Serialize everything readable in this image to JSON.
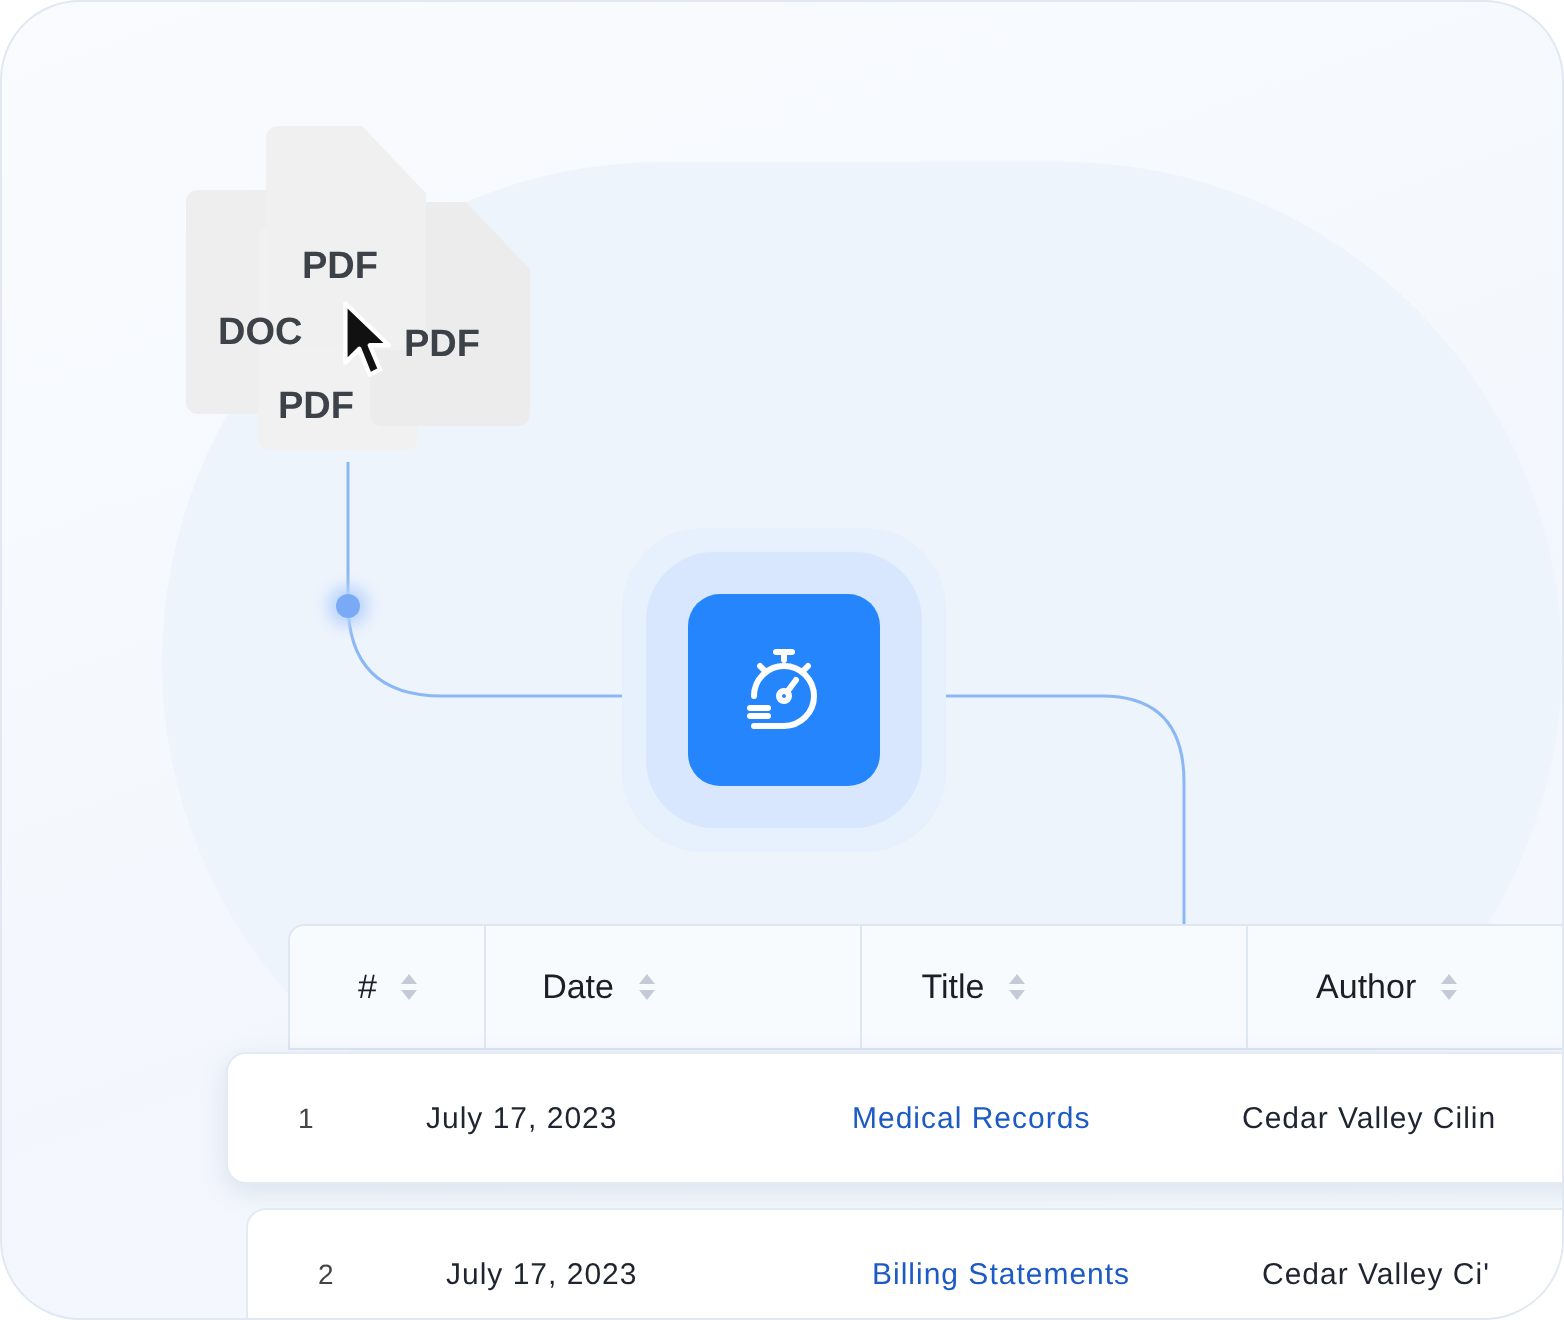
{
  "documents": [
    {
      "label": "DOC"
    },
    {
      "label": "PDF"
    },
    {
      "label": "PDF"
    },
    {
      "label": "PDF"
    }
  ],
  "table": {
    "columns": [
      {
        "label": "#"
      },
      {
        "label": "Date"
      },
      {
        "label": "Title"
      },
      {
        "label": "Author"
      }
    ],
    "rows": [
      {
        "number": "1",
        "date": "July 17, 2023",
        "title": "Medical Records",
        "author": "Cedar Valley Cilin",
        "raised": true
      },
      {
        "number": "2",
        "date": "July 17, 2023",
        "title": "Billing Statements",
        "author": "Cedar Valley Ci'",
        "raised": false
      }
    ]
  }
}
